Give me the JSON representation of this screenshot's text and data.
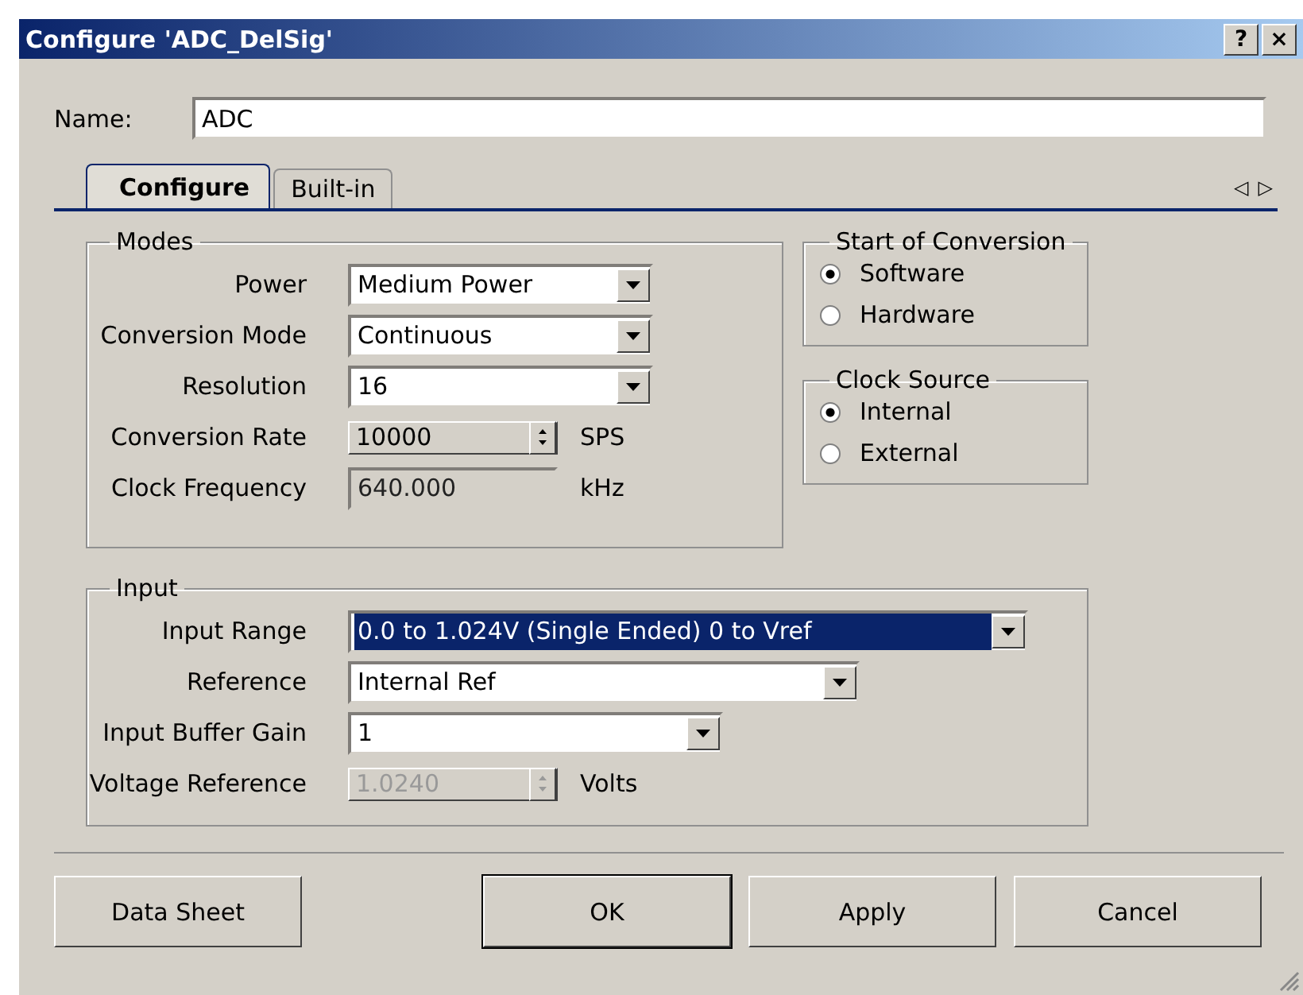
{
  "window": {
    "title": "Configure 'ADC_DelSig'",
    "title_buttons": [
      "?",
      "×"
    ]
  },
  "name_field": {
    "label": "Name:",
    "value": "ADC"
  },
  "tabs": [
    {
      "label": "Configure",
      "selected": true
    },
    {
      "label": "Built-in",
      "selected": false
    }
  ],
  "tab_scroll": [
    "◁",
    "▷"
  ],
  "modes": {
    "title": "Modes",
    "rows": [
      {
        "label": "Power",
        "kind": "dropdown",
        "value": "Medium Power",
        "disabled": false
      },
      {
        "label": "Conversion Mode",
        "kind": "dropdown",
        "value": "Continuous",
        "disabled": false
      },
      {
        "label": "Resolution",
        "kind": "dropdown",
        "value": "16",
        "disabled": false
      },
      {
        "label": "Conversion Rate",
        "kind": "spin",
        "value": "10000",
        "unit": "SPS",
        "disabled": false
      },
      {
        "label": "Clock Frequency",
        "kind": "readonly",
        "value": "640.000",
        "unit": "kHz",
        "disabled": false
      }
    ]
  },
  "start_of_conversion": {
    "title": "Start of Conversion",
    "options": [
      {
        "label": "Software",
        "selected": true
      },
      {
        "label": "Hardware",
        "selected": false
      }
    ]
  },
  "clock_source": {
    "title": "Clock Source",
    "options": [
      {
        "label": "Internal",
        "selected": true
      },
      {
        "label": "External",
        "selected": false
      }
    ]
  },
  "input": {
    "title": "Input",
    "rows": [
      {
        "label": "Input Range",
        "kind": "dropdown",
        "value": "0.0 to 1.024V (Single Ended) 0 to Vref",
        "focused": true,
        "disabled": false
      },
      {
        "label": "Reference",
        "kind": "dropdown",
        "value": "Internal Ref",
        "focused": false,
        "disabled": false
      },
      {
        "label": "Input Buffer Gain",
        "kind": "dropdown",
        "value": "1",
        "focused": false,
        "disabled": false
      },
      {
        "label": "Voltage Reference",
        "kind": "spin",
        "value": "1.0240",
        "unit": "Volts",
        "focused": false,
        "disabled": true
      }
    ]
  },
  "buttons": [
    {
      "label": "Data Sheet",
      "default": false
    },
    {
      "label": "OK",
      "default": true
    },
    {
      "label": "Apply",
      "default": false
    },
    {
      "label": "Cancel",
      "default": false
    }
  ]
}
